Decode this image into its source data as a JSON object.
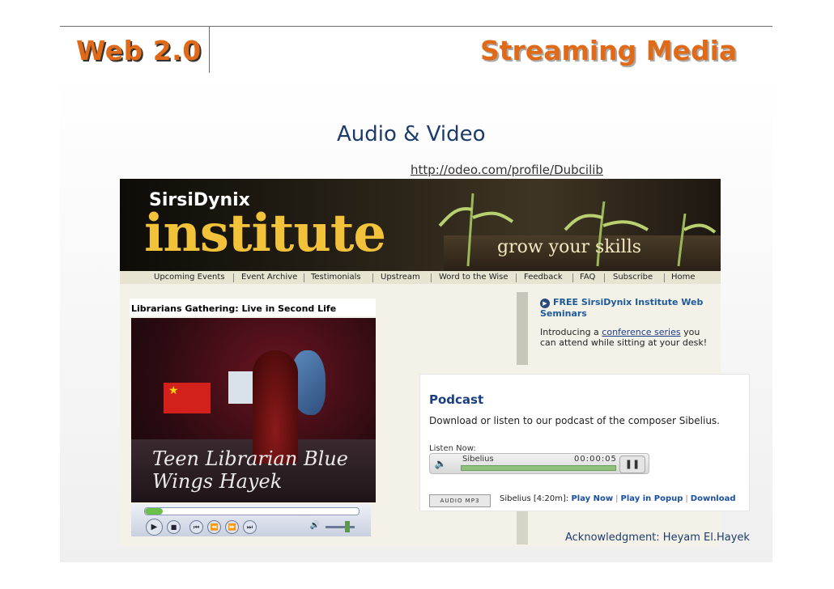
{
  "slide": {
    "header_left": "Web 2.0",
    "header_right": "Streaming Media",
    "subtitle": "Audio & Video",
    "url": "http://odeo.com/profile/Dubcilib",
    "acknowledgment": "Acknowledgment: Heyam El.Hayek"
  },
  "site": {
    "brand_top": "SirsiDynix",
    "brand_main": "institute",
    "tagline": "grow your skills",
    "nav": [
      "Upcoming Events",
      "Event Archive",
      "Testimonials",
      "Upstream",
      "Word to the Wise",
      "Feedback",
      "FAQ",
      "Subscribe",
      "Home"
    ],
    "video_title": "Librarians Gathering: Live in Second Life",
    "video_caption": "Teen Librarian Blue Wings Hayek",
    "promo_title": "FREE SirsiDynix Institute Web Seminars",
    "promo_text_before": "Introducing a",
    "promo_link": "conference series",
    "promo_text_after": "you can attend while sitting at your desk!"
  },
  "podcast": {
    "title": "Podcast",
    "description": "Download or listen to our podcast of the composer Sibelius.",
    "listen_label": "Listen Now:",
    "track_name": "Sibelius",
    "track_time": "00:00:05",
    "badge": "AUDIO MP3",
    "file_label": "Sibelius [4:20m]:",
    "links": [
      "Play Now",
      "Play in Popup",
      "Download"
    ]
  },
  "colors": {
    "header_accent": "#e06a18",
    "body_text": "#1c3b6b",
    "brand_gold": "#f2c23a",
    "podcast_blue": "#1a3f7f"
  }
}
